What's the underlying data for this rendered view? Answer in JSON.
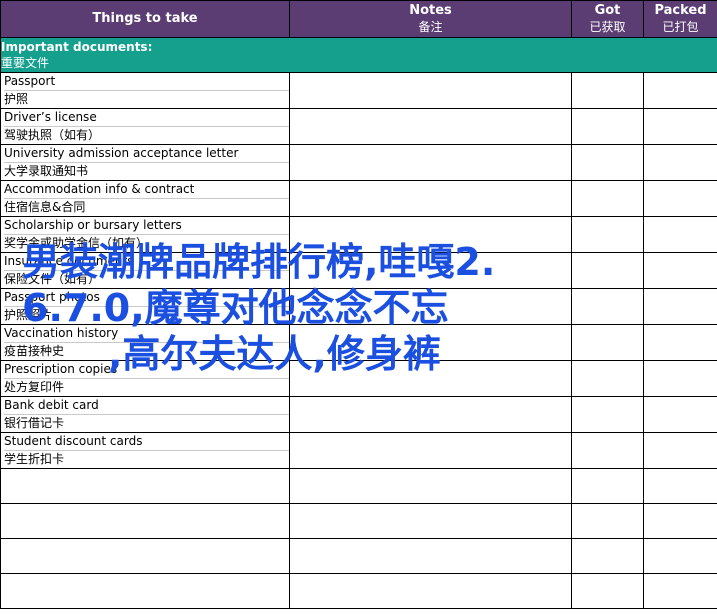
{
  "header": {
    "things": "Things to take",
    "notes_en": "Notes",
    "notes_zh": "备注",
    "got_en": "Got",
    "got_zh": "已获取",
    "packed_en": "Packed",
    "packed_zh": "已打包"
  },
  "section": {
    "title_en": "Important documents:",
    "title_zh": "重要文件"
  },
  "items": [
    {
      "en": "Passport",
      "zh": "护照"
    },
    {
      "en": "Driver’s license",
      "zh": "驾驶执照（如有）"
    },
    {
      "en": "University admission acceptance letter",
      "zh": "大学录取通知书"
    },
    {
      "en": "Accommodation info & contract",
      "zh": "住宿信息&合同"
    },
    {
      "en": "Scholarship or bursary letters",
      "zh": "奖学金或助学金信（如有）"
    },
    {
      "en": "Insurance documents",
      "zh": "保险文件（如有）"
    },
    {
      "en": "Passport photos",
      "zh": "护照照片"
    },
    {
      "en": "Vaccination history",
      "zh": "疫苗接种史"
    },
    {
      "en": "Prescription copies",
      "zh": "处方复印件"
    },
    {
      "en": "Bank debit card",
      "zh": "银行借记卡"
    },
    {
      "en": "Student discount cards",
      "zh": "学生折扣卡"
    }
  ],
  "watermark": {
    "line1": "男装潮牌品牌排行榜,哇嘎2.",
    "line2": "6.7.0,魔尊对他念念不忘",
    "line3": ",高尔夫达人,修身裤"
  },
  "colors": {
    "header_bg": "#5b3d73",
    "section_bg": "#15a08e",
    "watermark": "#1a4fe0"
  }
}
